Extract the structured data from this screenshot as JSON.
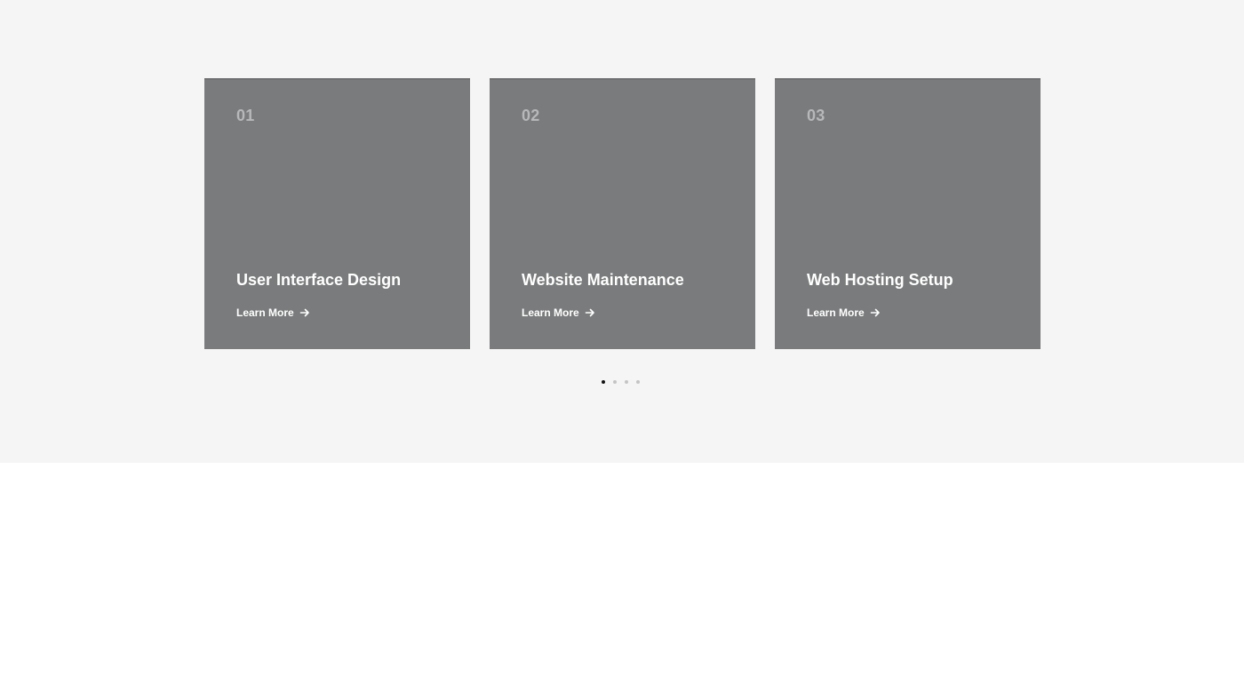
{
  "services": {
    "cards": [
      {
        "number": "01",
        "title": "User Interface Design",
        "link_label": "Learn More"
      },
      {
        "number": "02",
        "title": "Website Maintenance",
        "link_label": "Learn More"
      },
      {
        "number": "03",
        "title": "Web Hosting Setup",
        "link_label": "Learn More"
      }
    ],
    "pagination": {
      "total_pages": 4,
      "active_page": 1
    }
  },
  "icons": {
    "link_icon": "arrow-right-icon"
  },
  "colors": {
    "section_background": "#f5f5f5",
    "card_background": "#7a7b7c",
    "card_number": "#b7b8b9",
    "card_text": "#ffffff",
    "dot_active": "#111111",
    "dot_inactive": "#c4c4c4"
  }
}
